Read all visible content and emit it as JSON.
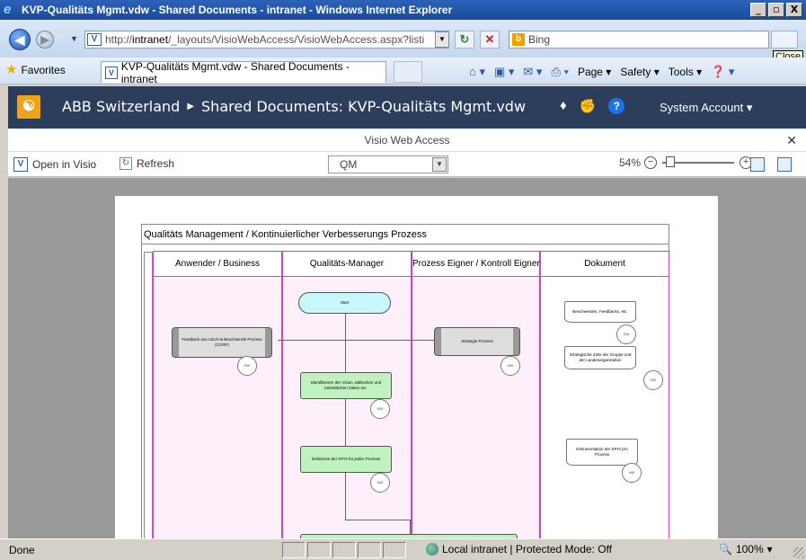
{
  "window": {
    "title": "KVP-Qualitäts Mgmt.vdw - Shared Documents - intranet - Windows Internet Explorer",
    "buttons": {
      "minimize": "_",
      "maximize": "▫",
      "close": "X"
    }
  },
  "address": {
    "url_prefix": "http://",
    "url_host": "intranet",
    "url_rest": "/_layouts/VisioWebAccess/VisioWebAccess.aspx?listi",
    "search_placeholder": "Bing",
    "tooltip": "Close"
  },
  "favorites": {
    "label": "Favorites",
    "tab_title": "KVP-Qualitäts Mgmt.vdw - Shared Documents - intranet",
    "commands": [
      "Page",
      "Safety",
      "Tools"
    ]
  },
  "sharepoint": {
    "site": "ABB Switzerland",
    "breadcrumb": "Shared Documents: KVP-Qualitäts Mgmt.vdw",
    "account": "System Account"
  },
  "vwa": {
    "title": "Visio Web Access",
    "open_in_visio": "Open in Visio",
    "refresh": "Refresh",
    "page": "QM",
    "zoom": "54%"
  },
  "diagram": {
    "title": "Qualitäts Management / Kontinuierlicher Verbesserungs Prozess",
    "lanes": [
      "Anwender / Business",
      "Qualitäts-Manager",
      "Prozess Eigner / Kontroll Eigner",
      "Dokument"
    ],
    "shapes": {
      "start": "Start",
      "feedback": "Feedback aus LEU's & Beschwerde Prozess (CCRP)",
      "strategie": "Strategie Prozess",
      "identify": "Identifizieren der Vision, taktischen und betrieblichen Zielen etc.",
      "define": "Definieren der KPI's für jeden Prozess",
      "doc1": "Beschwerden, Feedbacks, etc.",
      "doc2": "Strategische Ziele der Gruppe und der Landesorganisation",
      "doc3": "Dokumentation der KPI's pro Prozess"
    },
    "refs": {
      "feedback": "010",
      "strategie": "020",
      "identify": "030",
      "define": "040",
      "doc1": "010",
      "doc2": "020",
      "doc3": "040"
    }
  },
  "status": {
    "done": "Done",
    "zone": "Local intranet | Protected Mode: Off",
    "zoom": "100%"
  }
}
